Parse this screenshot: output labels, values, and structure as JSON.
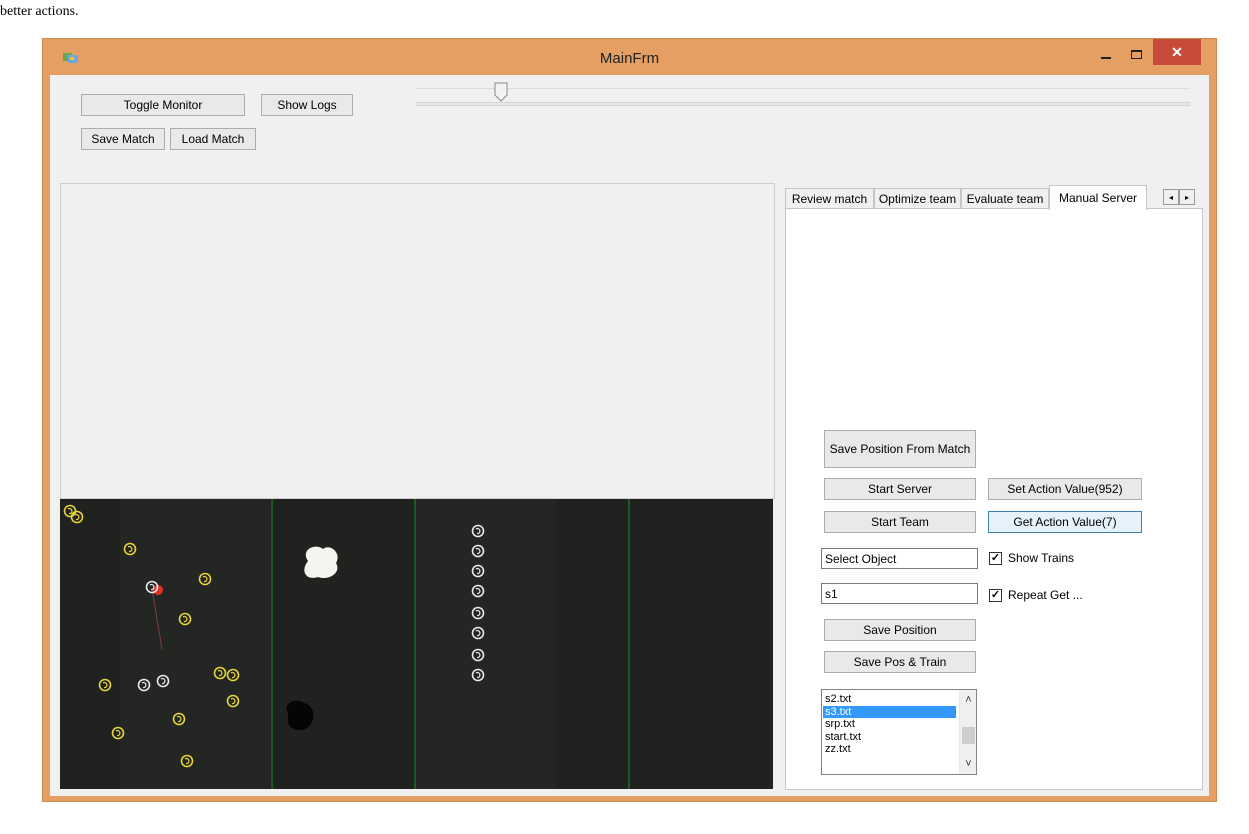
{
  "caption_text": "better actions.",
  "window": {
    "title": "MainFrm",
    "close_glyph": "✕"
  },
  "toolbar": {
    "toggle_monitor": "Toggle Monitor",
    "show_logs": "Show Logs",
    "save_match": "Save Match",
    "load_match": "Load Match",
    "slider_value_fraction": 0.1
  },
  "tabs": [
    {
      "label": "Review match",
      "active": false
    },
    {
      "label": "Optimize team",
      "active": false
    },
    {
      "label": "Evaluate team",
      "active": false
    },
    {
      "label": "Manual Server",
      "active": true
    }
  ],
  "tab_scroll": {
    "left": "◂",
    "right": "▸"
  },
  "manual_server": {
    "save_position_from_match": "Save Position From Match",
    "start_server": "Start Server",
    "set_action_value": "Set Action Value(952)",
    "start_team": "Start Team",
    "get_action_value": "Get Action Value(7)",
    "select_object_value": "Select Object",
    "show_trains": {
      "label": "Show Trains",
      "checked": true
    },
    "name_value": "s1",
    "repeat_get": {
      "label": "Repeat Get ...",
      "checked": true
    },
    "save_position": "Save Position",
    "save_pos_train": "Save Pos & Train",
    "files": [
      "s2.txt",
      "s3.txt",
      "srp.txt",
      "start.txt",
      "zz.txt"
    ],
    "selected_file": "s3.txt"
  },
  "field": {
    "field_color": "#1f221f",
    "line_color": "#1f8f2a",
    "yellow_team_color": "#e6d33a",
    "white_team_color": "#e8e8e8",
    "ball_color": "#e0302a"
  }
}
